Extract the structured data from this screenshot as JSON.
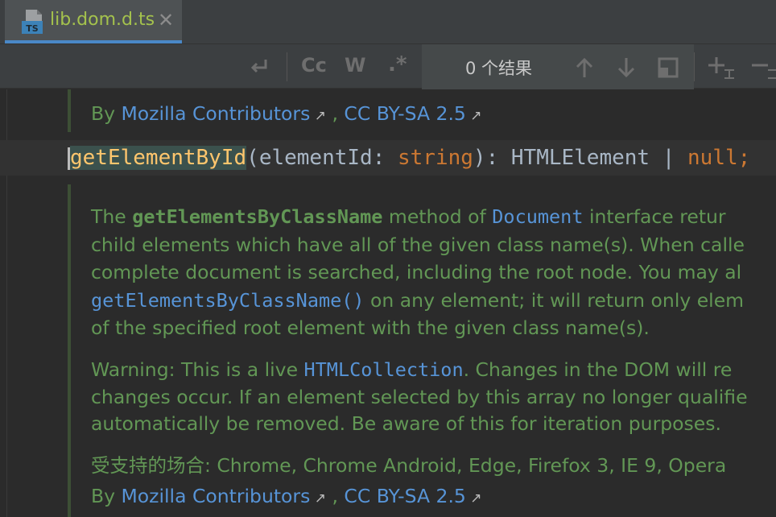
{
  "tab": {
    "title": "lib.dom.d.ts",
    "icon_label": "TS",
    "close_glyph": "✕"
  },
  "toolbar": {
    "match_case": "Cc",
    "whole_words": "W",
    "regex": ".*",
    "results": "0 个结果"
  },
  "code": {
    "name": "getElementById",
    "open": "(",
    "param": "elementId: ",
    "type": "string",
    "close": "): HTMLElement | ",
    "null_kw": "null",
    "semi": ";"
  },
  "doc_top": {
    "by": "By ",
    "contributors": "Mozilla Contributors",
    "sep": " , ",
    "license": "CC BY-SA 2.5"
  },
  "doc": {
    "p1_l1_a": "The ",
    "p1_l1_code": "getElementsByClassName",
    "p1_l1_b": " method of ",
    "p1_l1_link": "Document",
    "p1_l1_c": " interface retur",
    "p1_l2": "child elements which have all of the given class name(s). When calle",
    "p1_l3": "complete document is searched, including the root node. You may al",
    "p1_l4_code": "getElementsByClassName()",
    "p1_l4_b": " on any element; it will return only elem",
    "p1_l5": "of the specified root element with the given class name(s).",
    "p2_l1_a": "Warning: This is a live ",
    "p2_l1_link": "HTMLCollection",
    "p2_l1_b": ". Changes in the DOM will re",
    "p2_l2": "changes occur. If an element selected by this array no longer qualifie",
    "p2_l3": "automatically be removed. Be aware of this for iteration purposes.",
    "support": "受支持的场合: Chrome, Chrome Android, Edge, Firefox 3, IE 9, Opera",
    "by": "By ",
    "contributors": "Mozilla Contributors",
    "sep": " , ",
    "license": "CC BY-SA 2.5"
  },
  "colors": {
    "doc_green": "#629755",
    "link_blue": "#5794d7",
    "keyword_orange": "#cc7832",
    "function_yellow": "#ffc66d",
    "tab_accent": "#4a88c7"
  }
}
